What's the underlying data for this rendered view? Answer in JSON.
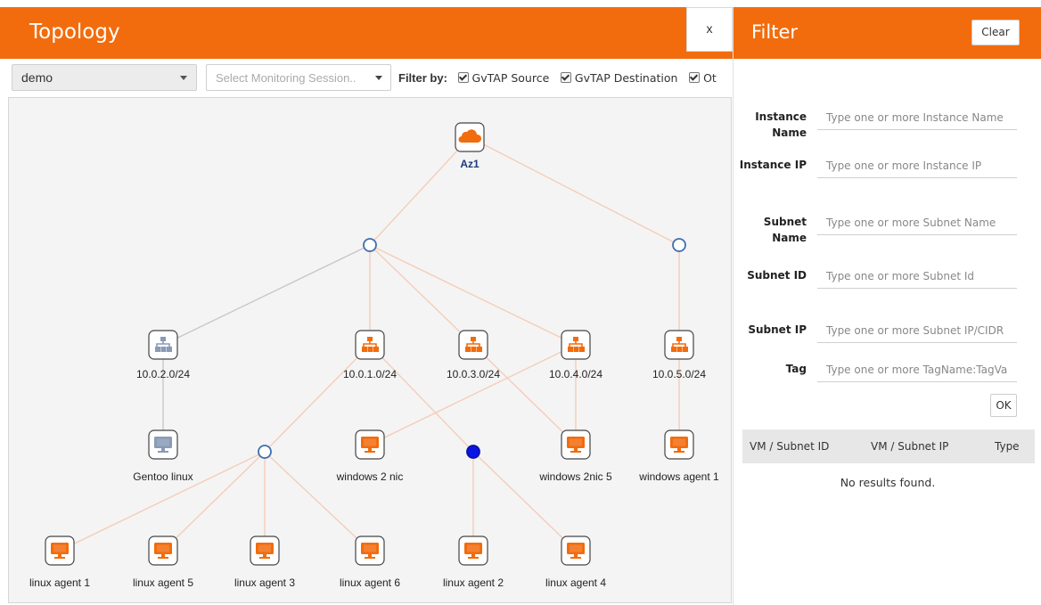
{
  "topology": {
    "title": "Topology",
    "close_label": "x",
    "toolbar": {
      "cloud_select_value": "demo",
      "session_select_placeholder": "Select Monitoring Session..",
      "filter_by_label": "Filter by:",
      "checkboxes": [
        {
          "label": "GvTAP Source",
          "checked": true
        },
        {
          "label": "GvTAP Destination",
          "checked": true
        },
        {
          "label": "Ot",
          "checked": true
        }
      ]
    },
    "nodes": {
      "az": "Az1",
      "subnets": [
        "10.0.2.0/24",
        "10.0.1.0/24",
        "10.0.3.0/24",
        "10.0.4.0/24",
        "10.0.5.0/24"
      ],
      "instances_row1": [
        "Gentoo linux",
        "windows 2 nic",
        "windows 2nic 5",
        "windows agent 1"
      ],
      "instances_row2": [
        "linux agent 1",
        "linux agent 5",
        "linux agent 3",
        "linux agent 6",
        "linux agent 2",
        "linux agent 4"
      ]
    },
    "colors": {
      "accent": "#f26c0d",
      "inactive": "#8a9bb5",
      "hub": "#3f6fb0",
      "selected_hub": "#0a14e6"
    }
  },
  "filter": {
    "title": "Filter",
    "clear_label": "Clear",
    "fields": [
      {
        "label": "Instance Name",
        "placeholder": "Type one or more Instance Name"
      },
      {
        "label": "Instance IP",
        "placeholder": "Type one or more Instance IP"
      },
      {
        "label": "Subnet Name",
        "placeholder": "Type one or more Subnet Name"
      },
      {
        "label": "Subnet ID",
        "placeholder": "Type one or more Subnet Id"
      },
      {
        "label": "Subnet IP",
        "placeholder": "Type one or more Subnet IP/CIDR"
      },
      {
        "label": "Tag",
        "placeholder": "Type one or more TagName:TagValue"
      }
    ],
    "ok_label": "OK",
    "table": {
      "columns": [
        "VM / Subnet ID",
        "VM / Subnet IP",
        "Type"
      ],
      "empty_message": "No results found."
    }
  }
}
